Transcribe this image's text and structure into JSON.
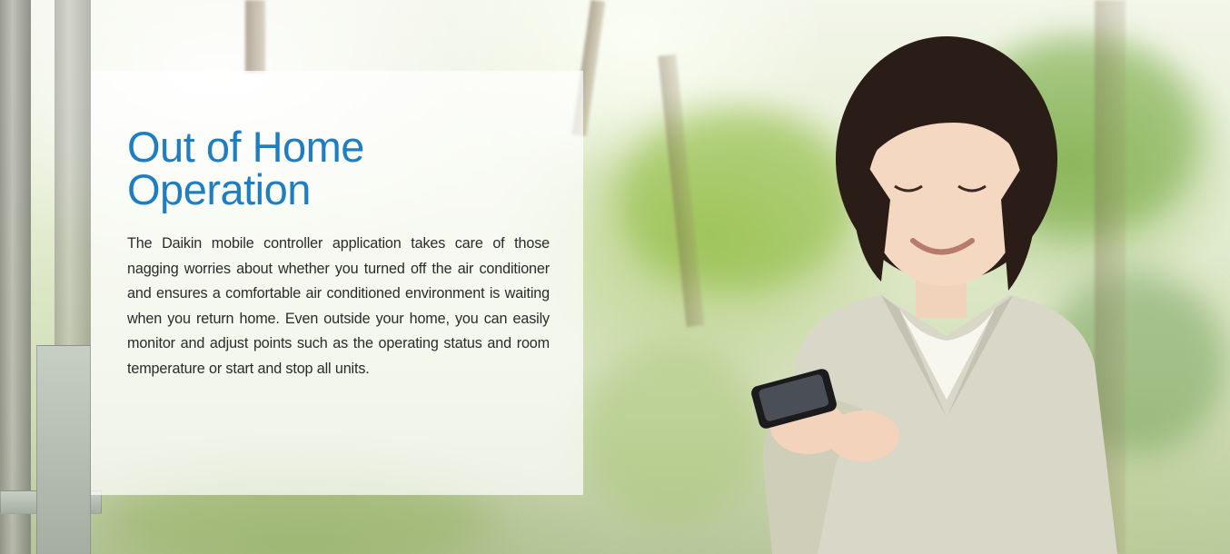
{
  "section": {
    "title": "Out of Home Operation",
    "body": "The Daikin mobile controller application takes care of those nagging worries about whether you turned off the air conditioner and ensures a comfortable air conditioned environment is waiting when you return home. Even outside your home, you can easily monitor and adjust points such as the operating status and room temperature or start and stop all units."
  },
  "colors": {
    "title": "#1f7ec2",
    "body_text": "#2b2b2b",
    "panel_background": "#ffffff"
  },
  "icons": {
    "phone": "smartphone-icon"
  }
}
